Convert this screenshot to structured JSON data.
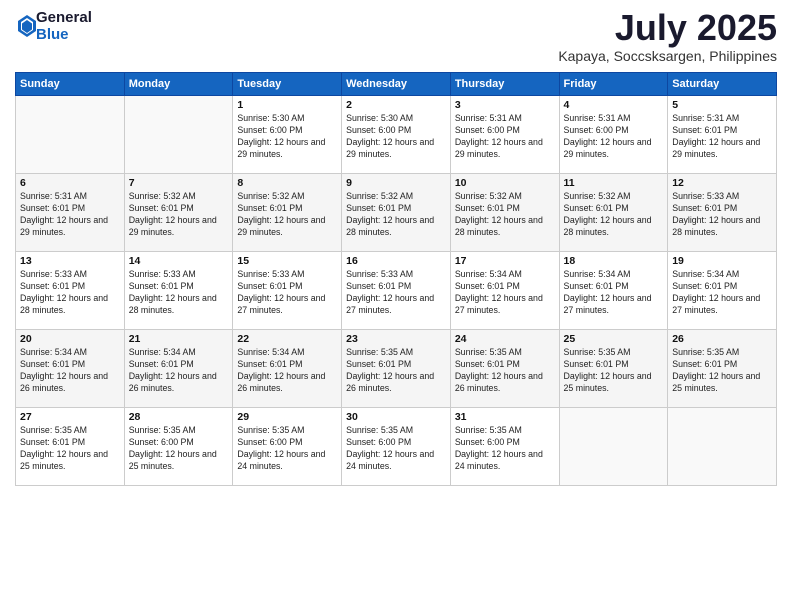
{
  "logo": {
    "general": "General",
    "blue": "Blue"
  },
  "title": {
    "month_year": "July 2025",
    "location": "Kapaya, Soccsksargen, Philippines"
  },
  "weekdays": [
    "Sunday",
    "Monday",
    "Tuesday",
    "Wednesday",
    "Thursday",
    "Friday",
    "Saturday"
  ],
  "weeks": [
    [
      {
        "day": "",
        "info": ""
      },
      {
        "day": "",
        "info": ""
      },
      {
        "day": "1",
        "info": "Sunrise: 5:30 AM\nSunset: 6:00 PM\nDaylight: 12 hours and 29 minutes."
      },
      {
        "day": "2",
        "info": "Sunrise: 5:30 AM\nSunset: 6:00 PM\nDaylight: 12 hours and 29 minutes."
      },
      {
        "day": "3",
        "info": "Sunrise: 5:31 AM\nSunset: 6:00 PM\nDaylight: 12 hours and 29 minutes."
      },
      {
        "day": "4",
        "info": "Sunrise: 5:31 AM\nSunset: 6:00 PM\nDaylight: 12 hours and 29 minutes."
      },
      {
        "day": "5",
        "info": "Sunrise: 5:31 AM\nSunset: 6:01 PM\nDaylight: 12 hours and 29 minutes."
      }
    ],
    [
      {
        "day": "6",
        "info": "Sunrise: 5:31 AM\nSunset: 6:01 PM\nDaylight: 12 hours and 29 minutes."
      },
      {
        "day": "7",
        "info": "Sunrise: 5:32 AM\nSunset: 6:01 PM\nDaylight: 12 hours and 29 minutes."
      },
      {
        "day": "8",
        "info": "Sunrise: 5:32 AM\nSunset: 6:01 PM\nDaylight: 12 hours and 29 minutes."
      },
      {
        "day": "9",
        "info": "Sunrise: 5:32 AM\nSunset: 6:01 PM\nDaylight: 12 hours and 28 minutes."
      },
      {
        "day": "10",
        "info": "Sunrise: 5:32 AM\nSunset: 6:01 PM\nDaylight: 12 hours and 28 minutes."
      },
      {
        "day": "11",
        "info": "Sunrise: 5:32 AM\nSunset: 6:01 PM\nDaylight: 12 hours and 28 minutes."
      },
      {
        "day": "12",
        "info": "Sunrise: 5:33 AM\nSunset: 6:01 PM\nDaylight: 12 hours and 28 minutes."
      }
    ],
    [
      {
        "day": "13",
        "info": "Sunrise: 5:33 AM\nSunset: 6:01 PM\nDaylight: 12 hours and 28 minutes."
      },
      {
        "day": "14",
        "info": "Sunrise: 5:33 AM\nSunset: 6:01 PM\nDaylight: 12 hours and 28 minutes."
      },
      {
        "day": "15",
        "info": "Sunrise: 5:33 AM\nSunset: 6:01 PM\nDaylight: 12 hours and 27 minutes."
      },
      {
        "day": "16",
        "info": "Sunrise: 5:33 AM\nSunset: 6:01 PM\nDaylight: 12 hours and 27 minutes."
      },
      {
        "day": "17",
        "info": "Sunrise: 5:34 AM\nSunset: 6:01 PM\nDaylight: 12 hours and 27 minutes."
      },
      {
        "day": "18",
        "info": "Sunrise: 5:34 AM\nSunset: 6:01 PM\nDaylight: 12 hours and 27 minutes."
      },
      {
        "day": "19",
        "info": "Sunrise: 5:34 AM\nSunset: 6:01 PM\nDaylight: 12 hours and 27 minutes."
      }
    ],
    [
      {
        "day": "20",
        "info": "Sunrise: 5:34 AM\nSunset: 6:01 PM\nDaylight: 12 hours and 26 minutes."
      },
      {
        "day": "21",
        "info": "Sunrise: 5:34 AM\nSunset: 6:01 PM\nDaylight: 12 hours and 26 minutes."
      },
      {
        "day": "22",
        "info": "Sunrise: 5:34 AM\nSunset: 6:01 PM\nDaylight: 12 hours and 26 minutes."
      },
      {
        "day": "23",
        "info": "Sunrise: 5:35 AM\nSunset: 6:01 PM\nDaylight: 12 hours and 26 minutes."
      },
      {
        "day": "24",
        "info": "Sunrise: 5:35 AM\nSunset: 6:01 PM\nDaylight: 12 hours and 26 minutes."
      },
      {
        "day": "25",
        "info": "Sunrise: 5:35 AM\nSunset: 6:01 PM\nDaylight: 12 hours and 25 minutes."
      },
      {
        "day": "26",
        "info": "Sunrise: 5:35 AM\nSunset: 6:01 PM\nDaylight: 12 hours and 25 minutes."
      }
    ],
    [
      {
        "day": "27",
        "info": "Sunrise: 5:35 AM\nSunset: 6:01 PM\nDaylight: 12 hours and 25 minutes."
      },
      {
        "day": "28",
        "info": "Sunrise: 5:35 AM\nSunset: 6:00 PM\nDaylight: 12 hours and 25 minutes."
      },
      {
        "day": "29",
        "info": "Sunrise: 5:35 AM\nSunset: 6:00 PM\nDaylight: 12 hours and 24 minutes."
      },
      {
        "day": "30",
        "info": "Sunrise: 5:35 AM\nSunset: 6:00 PM\nDaylight: 12 hours and 24 minutes."
      },
      {
        "day": "31",
        "info": "Sunrise: 5:35 AM\nSunset: 6:00 PM\nDaylight: 12 hours and 24 minutes."
      },
      {
        "day": "",
        "info": ""
      },
      {
        "day": "",
        "info": ""
      }
    ]
  ]
}
